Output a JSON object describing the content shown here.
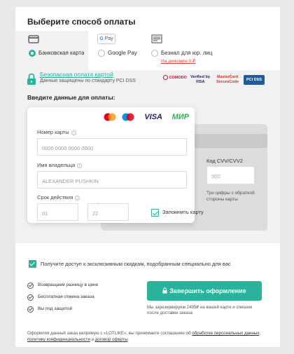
{
  "header": {
    "title": "Выберите способ оплаты"
  },
  "payment_tabs": [
    {
      "label": "Банковская карта",
      "selected": true
    },
    {
      "label": "Google Pay",
      "selected": false,
      "icon_text": "G Pay"
    },
    {
      "label": "Безнал для юр. лиц",
      "selected": false,
      "sublabel": "На депозите 0 ₽"
    }
  ],
  "security": {
    "link_text": "Безопасная оплата картой",
    "subtitle": "Данные защищены по стандарту PCI DSS",
    "badges": [
      "COMODO",
      "Verified by VISA",
      "MasterCard SecureCode",
      "PCI DSS"
    ]
  },
  "card_form": {
    "section_title": "Введите данные для оплаты:",
    "card_brands": [
      "mastercard",
      "maestro",
      "VISA",
      "МИР"
    ],
    "card_number": {
      "label": "Номер карты",
      "placeholder": "0000 0000 0000 0000"
    },
    "holder": {
      "label": "Имя владельца",
      "placeholder": "ALEXANDER PUSHKIN"
    },
    "expiry": {
      "label": "Срок действия",
      "month_placeholder": "01",
      "separator": "/",
      "year_placeholder": "22"
    },
    "remember": {
      "label": "Запомнить карту",
      "checked": true
    },
    "cvv": {
      "label": "Код CVV/CVV2",
      "placeholder": "000",
      "hint": "Три цифры с обратной стороны карты"
    }
  },
  "promo": {
    "label": "Получите доступ к эксклюзивным скидкам, подобранным специально для вас",
    "checked": true
  },
  "features": [
    "Возвращаем разницу в цене",
    "Бесплатная отмена заказа",
    "Вы под защитой"
  ],
  "submit": {
    "label": "Завершить оформление",
    "reserve_note": "Мы зарезервируем 2435₽ на вашей карте и спишем после доставки заказа"
  },
  "consent": {
    "prefix": "Оформляя данный заказ напрямую с «LOTLIKE», вы принимаете соглашение об ",
    "link1": "обработке персональных данных",
    "sep1": ", ",
    "link2": "политику конфиденциальности",
    "sep2": " и ",
    "link3": "договор оферты"
  },
  "colors": {
    "accent": "#2ab39b",
    "warning": "#e03c3c"
  }
}
